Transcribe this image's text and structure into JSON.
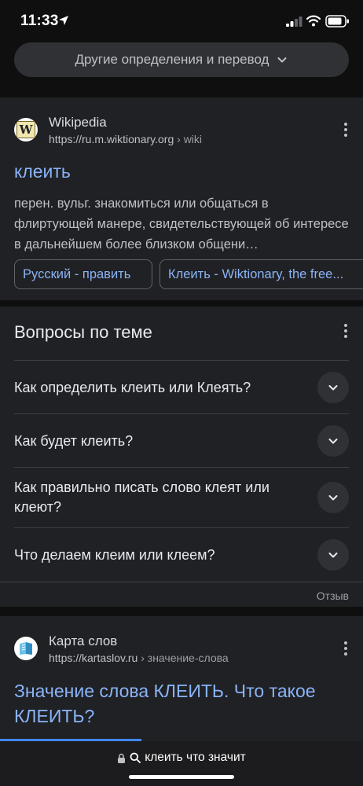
{
  "status_bar": {
    "time": "11:33"
  },
  "more_definitions": {
    "label": "Другие определения и перевод"
  },
  "result_wikipedia": {
    "site_name": "Wikipedia",
    "url": "https://ru.m.wiktionary.org",
    "breadcrumb": " › wiki",
    "favicon_letter": "W",
    "title": "клеить",
    "snippet": "перен. вульг. знакомиться или общаться в флиртующей манере, свидетельствующей об интересе в дальнейшем более близком общени…",
    "chips": [
      "Русский - править",
      "Клеить - Wiktionary, the free..."
    ]
  },
  "related_questions": {
    "heading": "Вопросы по теме",
    "items": [
      "Как определить клеить или Клеять?",
      "Как будет клеить?",
      "Как правильно писать слово клеят или клеют?",
      "Что делаем клеим или клеем?"
    ],
    "feedback": "Отзыв"
  },
  "result_kartaslov": {
    "site_name": "Карта слов",
    "url": "https://kartaslov.ru",
    "breadcrumb": " › значение-слова",
    "title": "Значение слова КЛЕИТЬ. Что такое КЛЕИТЬ?"
  },
  "url_bar": {
    "text": "клеить что значит"
  },
  "colors": {
    "background": "#0f0f0f",
    "card": "#202124",
    "link": "#8ab4f8",
    "accent_progress": "#4285f4"
  }
}
